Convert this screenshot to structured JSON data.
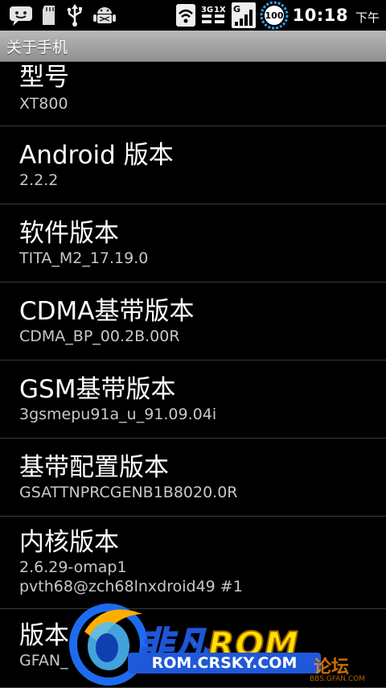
{
  "status_bar": {
    "icons_left": [
      "chat-icon",
      "sd-card-icon",
      "usb-icon",
      "android-debug-icon"
    ],
    "icons_right": [
      "wifi-icon",
      "data-3g-1x-icon",
      "signal-icon",
      "battery-icon"
    ],
    "badge_3g": "3G",
    "badge_1x": "1X",
    "badge_g": "G",
    "battery": "100",
    "time": "10:18",
    "ampm": "下午"
  },
  "title": "关于手机",
  "items": [
    {
      "title": "型号",
      "value": "XT800"
    },
    {
      "title": "Android 版本",
      "value": "2.2.2"
    },
    {
      "title": "软件版本",
      "value": "TITA_M2_17.19.0"
    },
    {
      "title": "CDMA基带版本",
      "value": "CDMA_BP_00.2B.00R"
    },
    {
      "title": "GSM基带版本",
      "value": "3gsmepu91a_u_91.09.04i"
    },
    {
      "title": "基带配置版本",
      "value": "GSATTNPRCGENB1B8020.0R"
    },
    {
      "title": "内核版本",
      "value": "2.6.29-omap1",
      "value2": "pvth68@zch68lnxdroid49 #1"
    },
    {
      "title": "版本",
      "value": "GFAN_"
    }
  ],
  "watermark": {
    "brand": "非凡",
    "rom": "RQM",
    "url": "ROM.CRSKY.COM",
    "forum": "论坛",
    "forum_url": "BBS.GFAN.COM"
  },
  "colors": {
    "background": "#000000",
    "title_bar": "#a4a4a4",
    "subtitle_text": "#c8c8c8",
    "divider": "#3a3a3a"
  }
}
